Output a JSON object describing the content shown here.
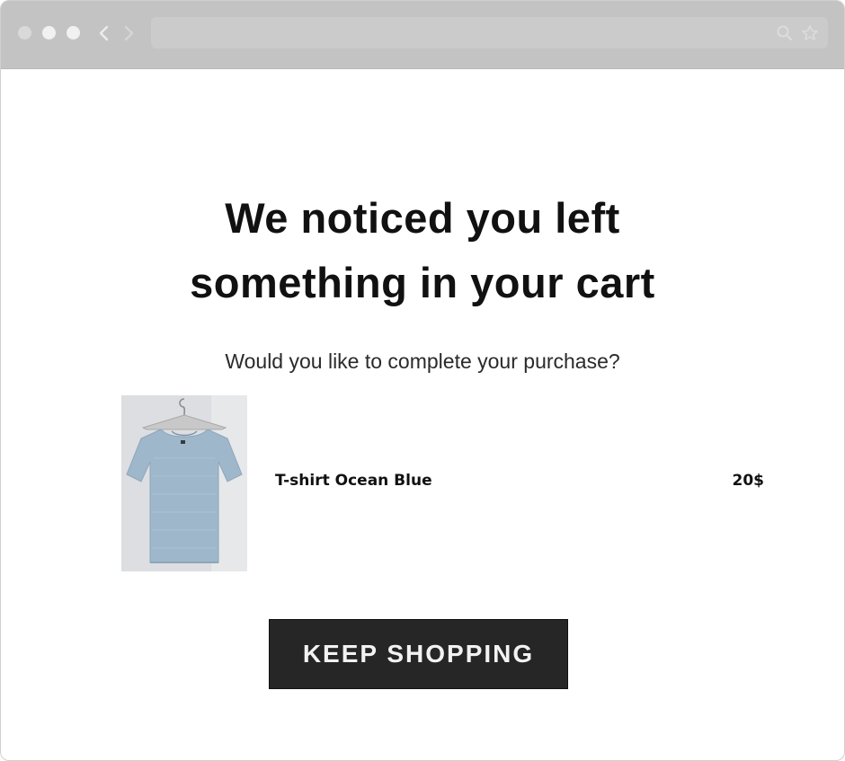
{
  "browser": {
    "controls": [
      "close",
      "minimize",
      "maximize"
    ],
    "nav_icons": [
      "chevron-left-icon",
      "chevron-right-icon"
    ],
    "url_icons": [
      "search-icon",
      "star-icon"
    ],
    "url": ""
  },
  "email": {
    "headline_line1": "We noticed you left",
    "headline_line2": "something in your cart",
    "subline": "Would you like to complete your purchase?",
    "product": {
      "name": "T-shirt Ocean Blue",
      "price": "20$",
      "image_icon": "tshirt-photo"
    },
    "cta_label": "KEEP SHOPPING"
  },
  "colors": {
    "chrome": "#c3c3c3",
    "cta_background": "#262626",
    "cta_text": "#f2f2f2",
    "text": "#111111",
    "tshirt": "#9fb7cb"
  }
}
